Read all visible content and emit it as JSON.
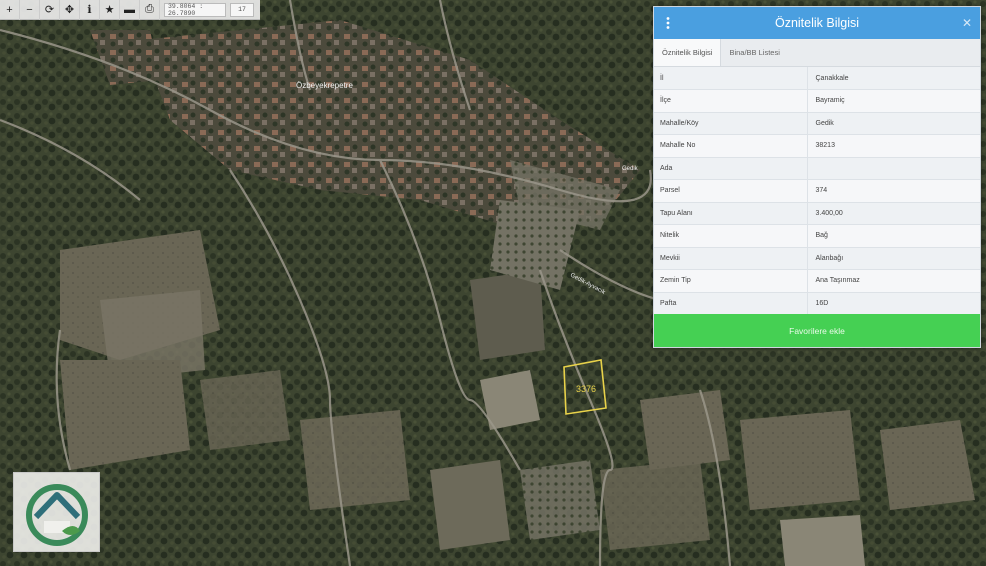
{
  "toolbar": {
    "coordinates": "39.8064 : 26.7890",
    "zoom": "17",
    "buttons": [
      "zoom-in",
      "zoom-out",
      "refresh",
      "locate",
      "info",
      "favorite",
      "measure",
      "print"
    ]
  },
  "map": {
    "place_label": "Özbeyekrepetre",
    "road_label_1": "Gedik",
    "road_label_2": "Gedik-Ayvacık",
    "parcel_label": "3376",
    "parcel_color": "#e8d24a"
  },
  "panel": {
    "title": "Öznitelik Bilgisi",
    "tabs": [
      {
        "label": "Öznitelik Bilgisi",
        "active": true
      },
      {
        "label": "Bina/BB Listesi",
        "active": false
      }
    ],
    "rows": [
      {
        "key": "İl",
        "value": "Çanakkale"
      },
      {
        "key": "İlçe",
        "value": "Bayramiç"
      },
      {
        "key": "Mahalle/Köy",
        "value": "Gedik"
      },
      {
        "key": "Mahalle No",
        "value": "38213"
      },
      {
        "key": "Ada",
        "value": ""
      },
      {
        "key": "Parsel",
        "value": "374"
      },
      {
        "key": "Tapu Alanı",
        "value": "3.400,00"
      },
      {
        "key": "Nitelik",
        "value": "Bağ"
      },
      {
        "key": "Mevkii",
        "value": "Alanbağı"
      },
      {
        "key": "Zemin Tip",
        "value": "Ana Taşınmaz"
      },
      {
        "key": "Pafta",
        "value": "16D"
      }
    ],
    "favorite_button": "Favorilere ekle",
    "header_color": "#4a9fe0",
    "button_color": "#45d053"
  }
}
